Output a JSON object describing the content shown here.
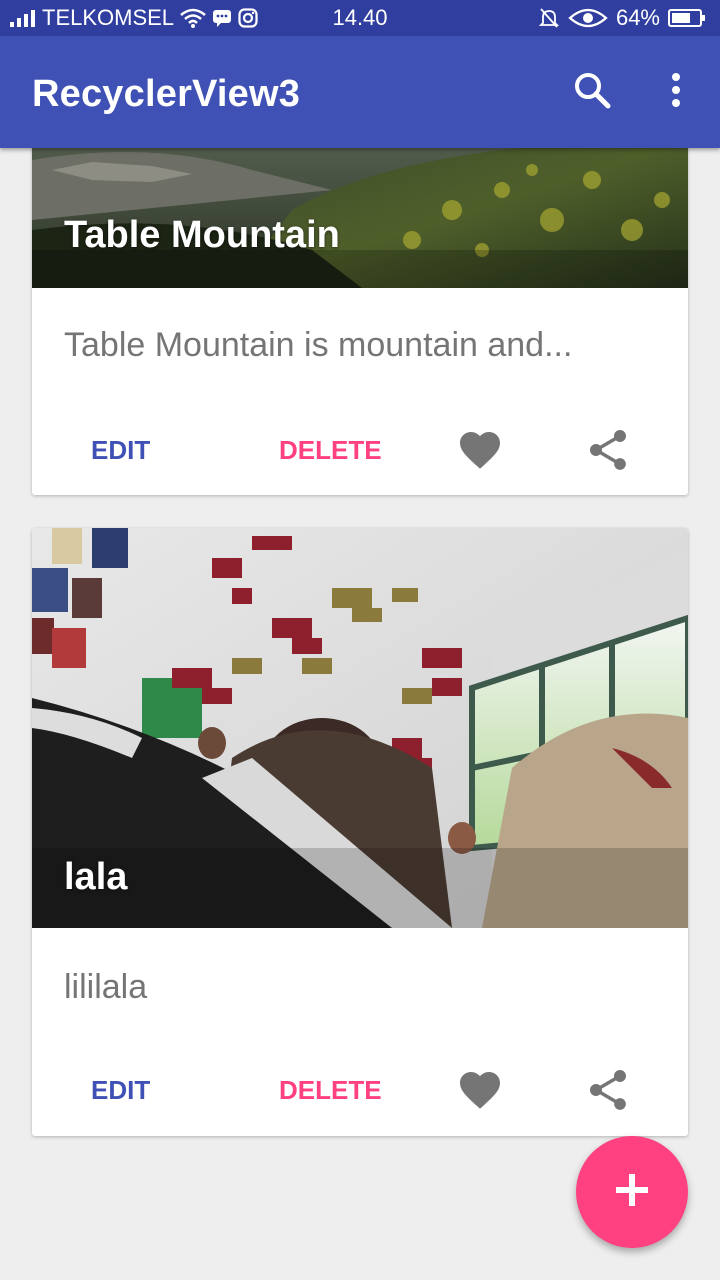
{
  "status_bar": {
    "carrier": "TELKOMSEL",
    "time": "14.40",
    "battery": "64%"
  },
  "app_bar": {
    "title": "RecyclerView3",
    "search_icon": "search-icon",
    "more_icon": "more-vert-icon",
    "color": "#3f51b5"
  },
  "cards": [
    {
      "title": "Table Mountain",
      "description": "Table Mountain is mountain and...",
      "edit_label": "EDIT",
      "delete_label": "DELETE",
      "favorite_icon": "heart-icon",
      "share_icon": "share-icon"
    },
    {
      "title": "lala",
      "description": "lililala",
      "edit_label": "EDIT",
      "delete_label": "DELETE",
      "favorite_icon": "heart-icon",
      "share_icon": "share-icon"
    }
  ],
  "fab": {
    "icon": "add-icon",
    "color": "#ff4081"
  },
  "colors": {
    "primary": "#3f51b5",
    "primary_dark": "#303f9f",
    "accent": "#ff4081"
  }
}
